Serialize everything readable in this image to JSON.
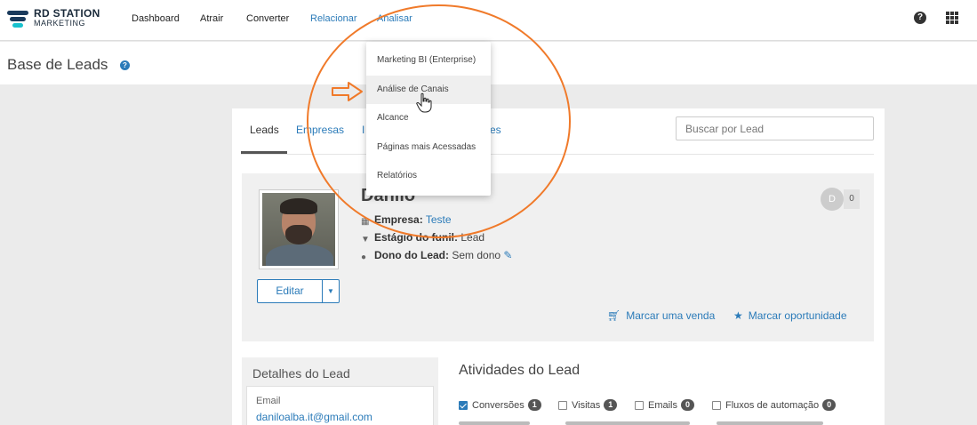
{
  "brand": {
    "line1": "RD STATION",
    "line2": "MARKETING"
  },
  "nav": {
    "items": [
      {
        "label": "Dashboard",
        "state": "normal"
      },
      {
        "label": "Atrair",
        "state": "normal"
      },
      {
        "label": "Converter",
        "state": "normal"
      },
      {
        "label": "Relacionar",
        "state": "active"
      },
      {
        "label": "Analisar",
        "state": "open"
      }
    ],
    "help_icon": "?",
    "apps_icon": "apps-grid-icon"
  },
  "page": {
    "title": "Base de Leads",
    "help_icon": "?"
  },
  "dropdown": {
    "items": [
      {
        "label": "Marketing BI (Enterprise)",
        "hover": false
      },
      {
        "label": "Análise de Canais",
        "hover": true
      },
      {
        "label": "Alcance",
        "hover": false
      },
      {
        "label": "Páginas mais Acessadas",
        "hover": false
      },
      {
        "label": "Relatórios",
        "hover": false
      }
    ]
  },
  "tabs": {
    "items": [
      {
        "label": "Leads",
        "state": "active"
      },
      {
        "label": "Empresas",
        "state": "link"
      },
      {
        "label": "I",
        "state": "link"
      },
      {
        "label": "es",
        "state": "link"
      }
    ],
    "search_placeholder": "Buscar por Lead"
  },
  "lead": {
    "name": "Danilo",
    "empresa_label": "Empresa:",
    "empresa_value": "Teste",
    "estagio_label": "Estágio do funil:",
    "estagio_value": "Lead",
    "dono_label": "Dono do Lead:",
    "dono_value": "Sem dono",
    "badge_letter": "D",
    "badge_count": "0",
    "edit_label": "Editar",
    "sale_label": "Marcar uma venda",
    "opportunity_label": "Marcar oportunidade"
  },
  "details": {
    "title": "Detalhes do Lead",
    "email_label": "Email",
    "email_value": "daniloalba.it@gmail.com"
  },
  "activities": {
    "title": "Atividades do Lead",
    "filters": [
      {
        "label": "Conversões",
        "count": "1",
        "checked": true
      },
      {
        "label": "Visitas",
        "count": "1",
        "checked": false
      },
      {
        "label": "Emails",
        "count": "0",
        "checked": false
      },
      {
        "label": "Fluxos de automação",
        "count": "0",
        "checked": false
      }
    ]
  },
  "colors": {
    "accent": "#2b7bb9",
    "annotation": "#f07a2a",
    "brand_dark": "#1a3a5c",
    "brand_teal": "#19c1ce"
  }
}
